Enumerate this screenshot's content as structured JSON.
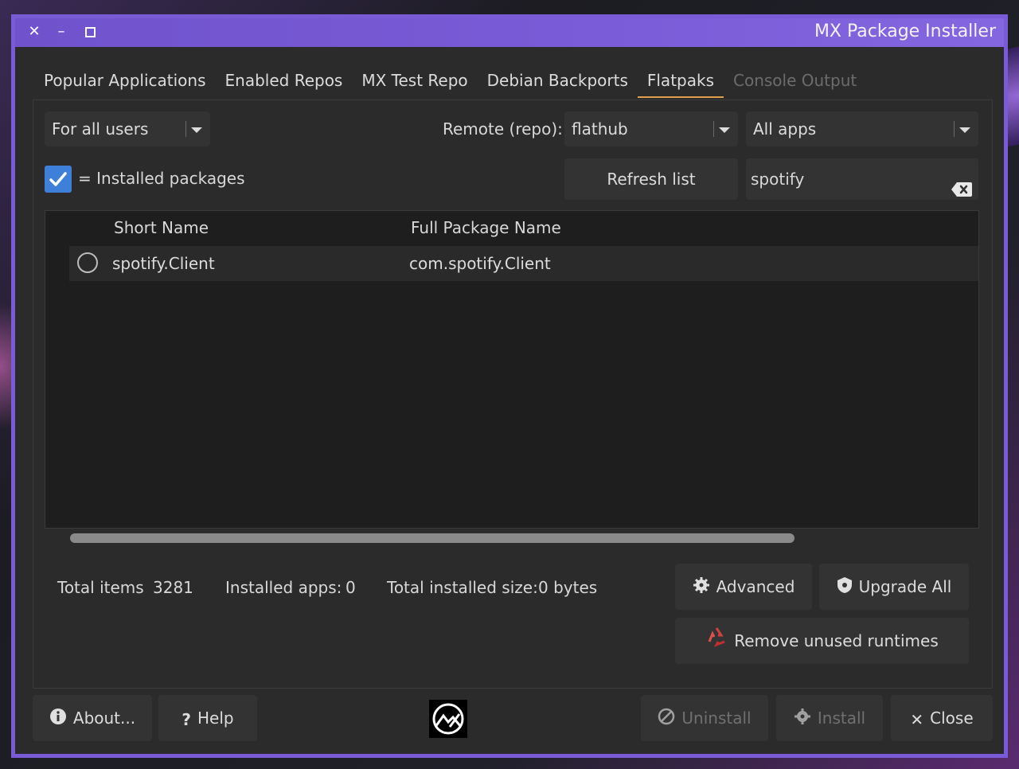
{
  "window": {
    "title": "MX Package Installer",
    "controls": {
      "close": "✕",
      "minimize": "–",
      "maximize": "◻"
    }
  },
  "tabs": [
    {
      "label": "Popular Applications"
    },
    {
      "label": "Enabled Repos"
    },
    {
      "label": "MX Test Repo"
    },
    {
      "label": "Debian Backports"
    },
    {
      "label": "Flatpaks"
    },
    {
      "label": "Console Output"
    }
  ],
  "flatpaks": {
    "user_scope": "For all users",
    "remote_label": "Remote (repo):",
    "remote_value": "flathub",
    "filter_value": "All apps",
    "installed_legend": "= Installed packages",
    "refresh_label": "Refresh list",
    "search_value": "spotify",
    "table": {
      "headers": [
        "Short Name",
        "Full Package Name"
      ],
      "rows": [
        {
          "short_name": "spotify.Client",
          "full_name": "com.spotify.Client"
        }
      ]
    },
    "stats": {
      "total_items_label": "Total items",
      "total_items_value": "3281",
      "installed_apps_label": "Installed apps:",
      "installed_apps_value": "0",
      "installed_size_label": "Total installed size:",
      "installed_size_value": "0 bytes"
    },
    "advanced_label": "Advanced",
    "upgrade_all_label": "Upgrade All",
    "remove_runtimes_label": "Remove unused runtimes"
  },
  "footer": {
    "about_label": "About...",
    "help_label": "Help",
    "uninstall_label": "Uninstall",
    "install_label": "Install",
    "close_label": "Close"
  },
  "colors": {
    "accent": "#7a5bd6",
    "checkbox": "#3d7fd9",
    "active_tab_underline": "#e0a04a"
  }
}
